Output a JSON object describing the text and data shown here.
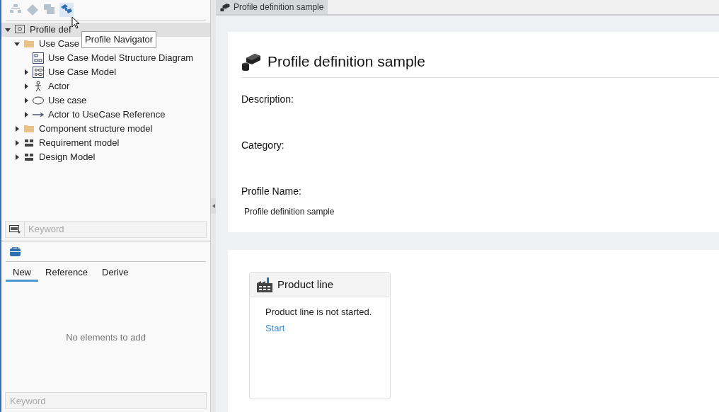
{
  "toolbar": [
    {
      "kind": "hierarchy",
      "disabled": true,
      "hovered": false
    },
    {
      "kind": "diamond",
      "disabled": true,
      "hovered": false
    },
    {
      "kind": "windows",
      "disabled": true,
      "hovered": false
    },
    {
      "kind": "navigator",
      "disabled": false,
      "hovered": true
    }
  ],
  "tooltip": "Profile Navigator",
  "tree": [
    {
      "label": "Profile def",
      "kind": "project",
      "selected": true,
      "expanded": true,
      "children": [
        {
          "label": "Use Case",
          "kind": "folder",
          "selected": false,
          "expanded": true,
          "children": [
            {
              "label": "Use Case Model Structure Diagram",
              "kind": "diagram",
              "selected": false
            },
            {
              "label": "Use Case Model",
              "kind": "model",
              "selected": false,
              "expanded": false
            },
            {
              "label": "Actor",
              "kind": "actor",
              "selected": false,
              "expanded": false
            },
            {
              "label": "Use case",
              "kind": "usecase",
              "selected": false,
              "expanded": false
            },
            {
              "label": "Actor to UseCase Reference",
              "kind": "reference",
              "selected": false,
              "expanded": false
            }
          ]
        },
        {
          "label": "Component structure model",
          "kind": "folder",
          "selected": false,
          "expanded": false
        },
        {
          "label": "Requirement model",
          "kind": "package",
          "selected": false,
          "expanded": false
        },
        {
          "label": "Design Model",
          "kind": "package",
          "selected": false,
          "expanded": false
        }
      ]
    }
  ],
  "tree_search": {
    "placeholder": "Keyword"
  },
  "toolbox": {
    "tabs": [
      {
        "label": "New",
        "selected": true
      },
      {
        "label": "Reference",
        "selected": false
      },
      {
        "label": "Derive",
        "selected": false
      }
    ],
    "empty_message": "No elements to add",
    "search": {
      "placeholder": "Keyword"
    }
  },
  "editor_tab": {
    "label": "Profile definition sample",
    "selected": true
  },
  "profile": {
    "title": "Profile definition sample",
    "fields": [
      {
        "label": "Description:"
      },
      {
        "label": "Category:"
      },
      {
        "label": "Profile Name:",
        "value": "Profile definition sample"
      }
    ]
  },
  "product_line": {
    "title": "Product line",
    "message": "Product line is not started.",
    "link": "Start"
  }
}
